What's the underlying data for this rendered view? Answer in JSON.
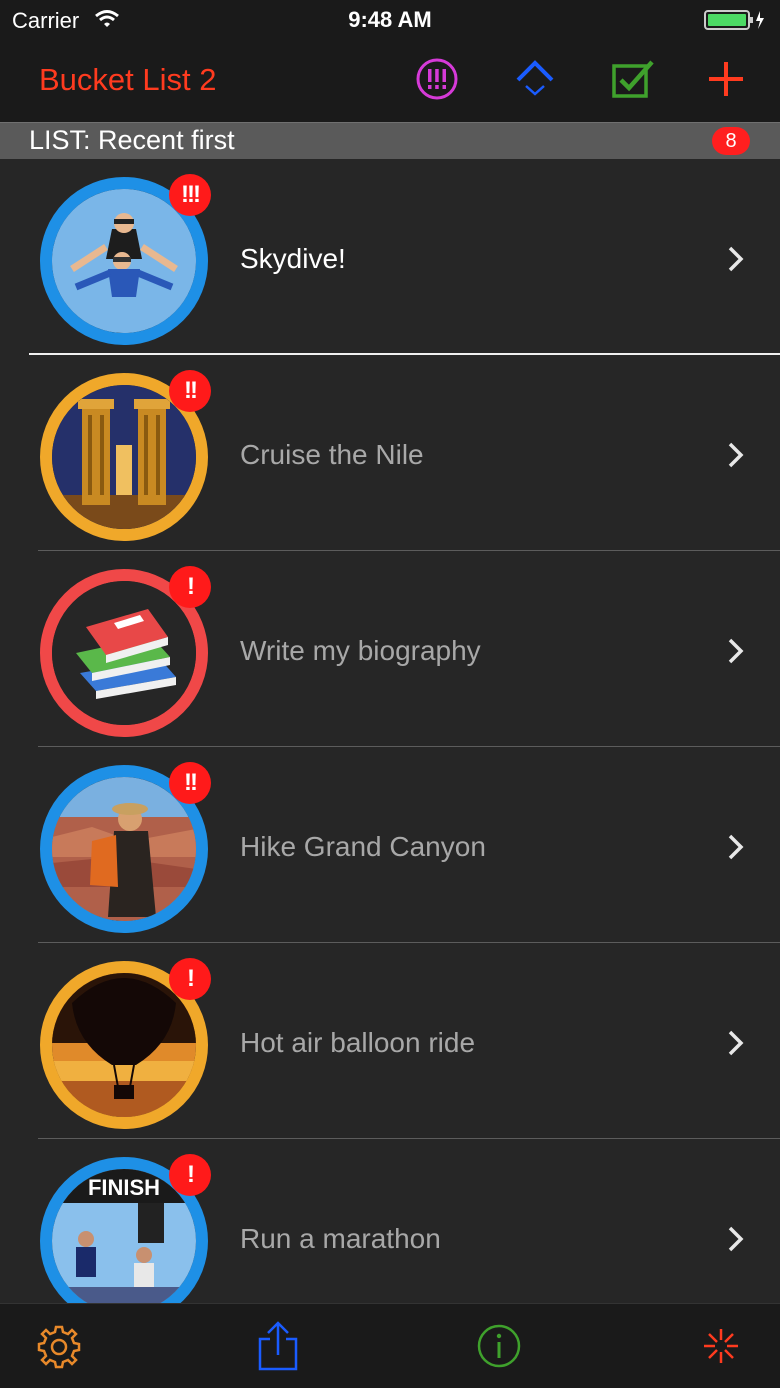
{
  "status_bar": {
    "carrier": "Carrier",
    "time": "9:48 AM"
  },
  "nav": {
    "title": "Bucket List 2",
    "buttons": [
      "priority-filter-icon",
      "sort-icon",
      "checkbox-icon",
      "add-icon"
    ],
    "colors": {
      "title": "#ff3b1f",
      "priority": "#d63ad8",
      "sort": "#1a5cff",
      "check": "#3fa12c",
      "add": "#ff3b1f"
    }
  },
  "section": {
    "title": "LIST: Recent first",
    "count": "8"
  },
  "items": [
    {
      "title": "Skydive!",
      "priority": "!!!",
      "ring": "#1e90e6",
      "image": "skydive"
    },
    {
      "title": "Cruise the Nile",
      "priority": "!!",
      "ring": "#f0a82a",
      "image": "temple"
    },
    {
      "title": "Write my biography",
      "priority": "!",
      "ring": "#f04848",
      "image": "books"
    },
    {
      "title": "Hike Grand Canyon",
      "priority": "!!",
      "ring": "#1e90e6",
      "image": "canyon"
    },
    {
      "title": "Hot air balloon ride",
      "priority": "!",
      "ring": "#f0a82a",
      "image": "balloon"
    },
    {
      "title": "Run a marathon",
      "priority": "!",
      "ring": "#1e90e6",
      "image": "marathon",
      "finish_text": "FINISH"
    }
  ],
  "toolbar": [
    "settings-icon",
    "share-icon",
    "info-icon",
    "activity-icon"
  ]
}
